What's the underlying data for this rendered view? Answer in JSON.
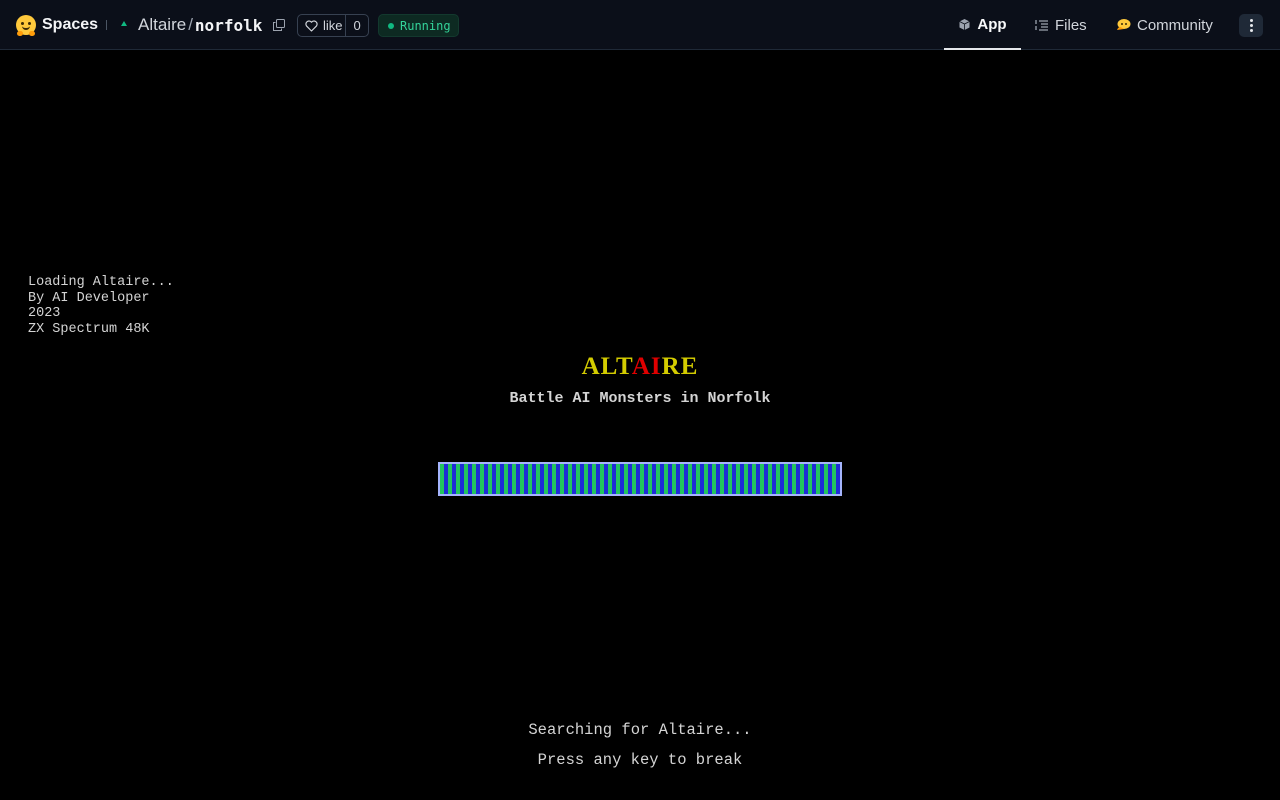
{
  "header": {
    "brand_label": "Spaces",
    "owner": "Altaire",
    "separator": "/",
    "repo_name": "norfolk",
    "like_label": "like",
    "like_count": "0",
    "status_label": "Running",
    "status_color": "#10b981",
    "tabs": [
      {
        "label": "App",
        "icon": "cube-icon",
        "active": true
      },
      {
        "label": "Files",
        "icon": "files-icon",
        "active": false
      },
      {
        "label": "Community",
        "icon": "community-icon",
        "active": false
      }
    ]
  },
  "app": {
    "loading_lines": [
      "Loading Altaire...",
      "By AI Developer",
      "2023",
      "ZX Spectrum 48K"
    ],
    "title_parts": [
      "ALT",
      "AI",
      "RE"
    ],
    "title_colors": {
      "main": "#d4cc00",
      "highlight": "#e00000"
    },
    "subtitle": "Battle AI Monsters in Norfolk",
    "progress_colors": [
      "#22c55e",
      "#1e2bd8"
    ],
    "search_text": "Searching for Altaire...",
    "break_text": "Press any key to break"
  }
}
